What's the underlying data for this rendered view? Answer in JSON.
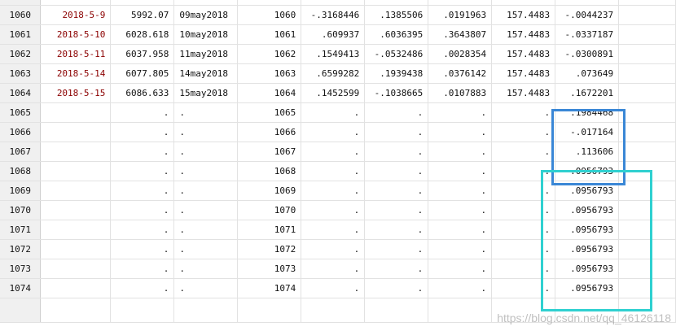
{
  "table": {
    "rows": [
      {
        "n": "1060",
        "date": "2018-5-9",
        "c3": "5992.07",
        "c4": "09may2018",
        "c5": "1060",
        "c6": "-.3168446",
        "c7": ".1385506",
        "c8": ".0191963",
        "c9": "157.4483",
        "c10": "-.0044237"
      },
      {
        "n": "1061",
        "date": "2018-5-10",
        "c3": "6028.618",
        "c4": "10may2018",
        "c5": "1061",
        "c6": ".609937",
        "c7": ".6036395",
        "c8": ".3643807",
        "c9": "157.4483",
        "c10": "-.0337187"
      },
      {
        "n": "1062",
        "date": "2018-5-11",
        "c3": "6037.958",
        "c4": "11may2018",
        "c5": "1062",
        "c6": ".1549413",
        "c7": "-.0532486",
        "c8": ".0028354",
        "c9": "157.4483",
        "c10": "-.0300891"
      },
      {
        "n": "1063",
        "date": "2018-5-14",
        "c3": "6077.805",
        "c4": "14may2018",
        "c5": "1063",
        "c6": ".6599282",
        "c7": ".1939438",
        "c8": ".0376142",
        "c9": "157.4483",
        "c10": ".073649"
      },
      {
        "n": "1064",
        "date": "2018-5-15",
        "c3": "6086.633",
        "c4": "15may2018",
        "c5": "1064",
        "c6": ".1452599",
        "c7": "-.1038665",
        "c8": ".0107883",
        "c9": "157.4483",
        "c10": ".1672201"
      },
      {
        "n": "1065",
        "date": "",
        "c3": ".",
        "c4": ".",
        "c5": "1065",
        "c6": ".",
        "c7": ".",
        "c8": ".",
        "c9": ".",
        "c10": ".1984468"
      },
      {
        "n": "1066",
        "date": "",
        "c3": ".",
        "c4": ".",
        "c5": "1066",
        "c6": ".",
        "c7": ".",
        "c8": ".",
        "c9": ".",
        "c10": "-.017164"
      },
      {
        "n": "1067",
        "date": "",
        "c3": ".",
        "c4": ".",
        "c5": "1067",
        "c6": ".",
        "c7": ".",
        "c8": ".",
        "c9": ".",
        "c10": ".113606"
      },
      {
        "n": "1068",
        "date": "",
        "c3": ".",
        "c4": ".",
        "c5": "1068",
        "c6": ".",
        "c7": ".",
        "c8": ".",
        "c9": ".",
        "c10": ".0956793"
      },
      {
        "n": "1069",
        "date": "",
        "c3": ".",
        "c4": ".",
        "c5": "1069",
        "c6": ".",
        "c7": ".",
        "c8": ".",
        "c9": ".",
        "c10": ".0956793"
      },
      {
        "n": "1070",
        "date": "",
        "c3": ".",
        "c4": ".",
        "c5": "1070",
        "c6": ".",
        "c7": ".",
        "c8": ".",
        "c9": ".",
        "c10": ".0956793"
      },
      {
        "n": "1071",
        "date": "",
        "c3": ".",
        "c4": ".",
        "c5": "1071",
        "c6": ".",
        "c7": ".",
        "c8": ".",
        "c9": ".",
        "c10": ".0956793"
      },
      {
        "n": "1072",
        "date": "",
        "c3": ".",
        "c4": ".",
        "c5": "1072",
        "c6": ".",
        "c7": ".",
        "c8": ".",
        "c9": ".",
        "c10": ".0956793"
      },
      {
        "n": "1073",
        "date": "",
        "c3": ".",
        "c4": ".",
        "c5": "1073",
        "c6": ".",
        "c7": ".",
        "c8": ".",
        "c9": ".",
        "c10": ".0956793"
      },
      {
        "n": "1074",
        "date": "",
        "c3": ".",
        "c4": ".",
        "c5": "1074",
        "c6": ".",
        "c7": ".",
        "c8": ".",
        "c9": ".",
        "c10": ".0956793"
      }
    ]
  },
  "watermark": "https://blog.csdn.net/qq_46126118",
  "colors": {
    "date_text": "#8b0000",
    "highlight_blue": "#3a87d6",
    "highlight_cyan": "#2fd0d0"
  }
}
